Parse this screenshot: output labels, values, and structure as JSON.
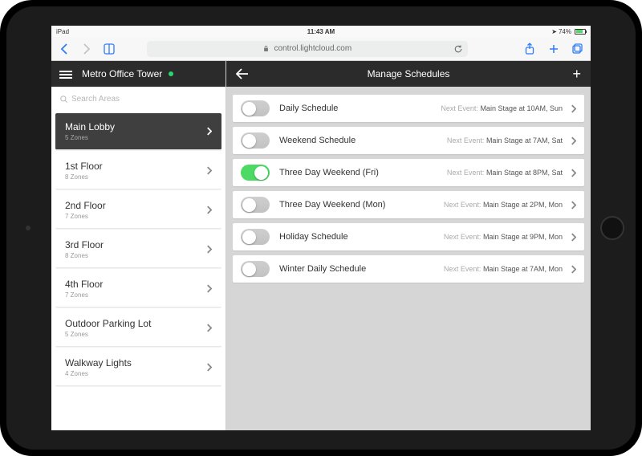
{
  "statusbar": {
    "device": "iPad",
    "wifi": true,
    "time": "11:43 AM",
    "battery_pct": "74%"
  },
  "safari": {
    "url": "control.lightcloud.com"
  },
  "sidebar": {
    "title": "Metro Office Tower",
    "search_placeholder": "Search Areas",
    "areas": [
      {
        "name": "Main Lobby",
        "zones": "5 Zones",
        "selected": true
      },
      {
        "name": "1st Floor",
        "zones": "8 Zones"
      },
      {
        "name": "2nd Floor",
        "zones": "7 Zones"
      },
      {
        "name": "3rd Floor",
        "zones": "8 Zones"
      },
      {
        "name": "4th Floor",
        "zones": "7 Zones"
      },
      {
        "name": "Outdoor Parking Lot",
        "zones": "5 Zones"
      },
      {
        "name": "Walkway Lights",
        "zones": "4 Zones"
      }
    ]
  },
  "main": {
    "header_title": "Manage Schedules",
    "next_event_label": "Next Event:",
    "schedules": [
      {
        "name": "Daily Schedule",
        "enabled": false,
        "next_event": "Main Stage at 10AM, Sun"
      },
      {
        "name": "Weekend Schedule",
        "enabled": false,
        "next_event": "Main Stage at 7AM, Sat"
      },
      {
        "name": "Three Day Weekend (Fri)",
        "enabled": true,
        "next_event": "Main Stage at 8PM, Sat"
      },
      {
        "name": "Three Day Weekend (Mon)",
        "enabled": false,
        "next_event": "Main Stage at 2PM, Mon"
      },
      {
        "name": "Holiday Schedule",
        "enabled": false,
        "next_event": "Main Stage at 9PM, Mon"
      },
      {
        "name": "Winter Daily Schedule",
        "enabled": false,
        "next_event": "Main Stage at 7AM, Mon"
      }
    ]
  }
}
